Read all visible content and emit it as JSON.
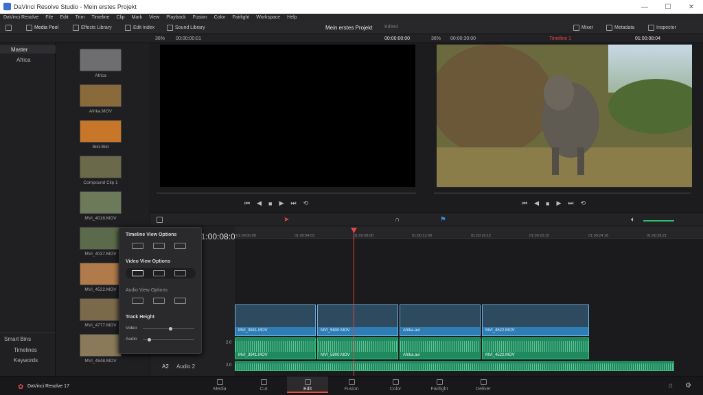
{
  "window": {
    "title": "DaVinci Resolve Studio - Mein erstes Projekt",
    "controls": [
      "—",
      "☐",
      "✕"
    ]
  },
  "menu": [
    "DaVinci Resolve",
    "File",
    "Edit",
    "Trim",
    "Timeline",
    "Clip",
    "Mark",
    "View",
    "Playback",
    "Fusion",
    "Color",
    "Fairlight",
    "Workspace",
    "Help"
  ],
  "toolbar": {
    "media_pool": "Media Pool",
    "effects_library": "Effects Library",
    "edit_index": "Edit Index",
    "sound_library": "Sound Library",
    "project_title": "Mein erstes Projekt",
    "edited": "Edited",
    "mixer": "Mixer",
    "metadata": "Metadata",
    "inspector": "Inspector"
  },
  "viewer_left": {
    "zoom": "36%",
    "timecode_in": "00:00:00:01",
    "timecode_out": "00:00:00:00"
  },
  "viewer_right": {
    "zoom": "36%",
    "duration": "00:00:30:00",
    "timeline_name": "Timeline 1",
    "timecode": "01:00:08:04"
  },
  "bins": {
    "master": "Master",
    "africa": "Africa",
    "smart_bins": "Smart Bins",
    "timelines": "Timelines",
    "keywords": "Keywords"
  },
  "clips": [
    {
      "name": "Africa",
      "color": "#7a7a7a"
    },
    {
      "name": "Afrika.MOV",
      "color": "#8a6a3a"
    },
    {
      "name": "Bild-Bild",
      "color": "#c8762a"
    },
    {
      "name": "Compound Clip 1",
      "color": "#6a6a4a"
    },
    {
      "name": "MVI_4018.MOV",
      "color": "#6d7a5a"
    },
    {
      "name": "MVI_4037.MOV",
      "color": "#5a6a4a"
    },
    {
      "name": "MVI_4522.MOV",
      "color": "#b07a4a"
    },
    {
      "name": "MVI_4777.MOV",
      "color": "#7a6a4a"
    },
    {
      "name": "MVI_4848.MOV",
      "color": "#8a7a5a"
    }
  ],
  "timeline": {
    "timecode": "01:00:08:04",
    "ruler": [
      "01:00:00:00",
      "01:00:04:03",
      "01:00:08:06",
      "01:00:12:09",
      "01:00:16:12",
      "01:00:20:15",
      "01:00:24:18",
      "01:00:28:21"
    ],
    "video_clips": [
      "MVI_3941.MOV",
      "MVI_5800.MOV",
      "Afrika.avi",
      "MVI_4522.MOV"
    ],
    "audio_clips": [
      "MVI_3941.MOV",
      "MVI_5800.MOV",
      "Afrika.avi",
      "MVI_4522.MOV"
    ],
    "track_a2": "A2",
    "track_a2_name": "Audio 2",
    "level_a1": "2.0",
    "level_a2": "2.0"
  },
  "popup": {
    "timeline_view": "Timeline View Options",
    "video_view": "Video View Options",
    "audio_view": "Audio View Options",
    "track_height": "Track Height",
    "video": "Video",
    "audio": "Audio"
  },
  "pages": [
    "Media",
    "Cut",
    "Edit",
    "Fusion",
    "Color",
    "Fairlight",
    "Deliver"
  ],
  "footer": {
    "app": "DaVinci Resolve 17"
  }
}
